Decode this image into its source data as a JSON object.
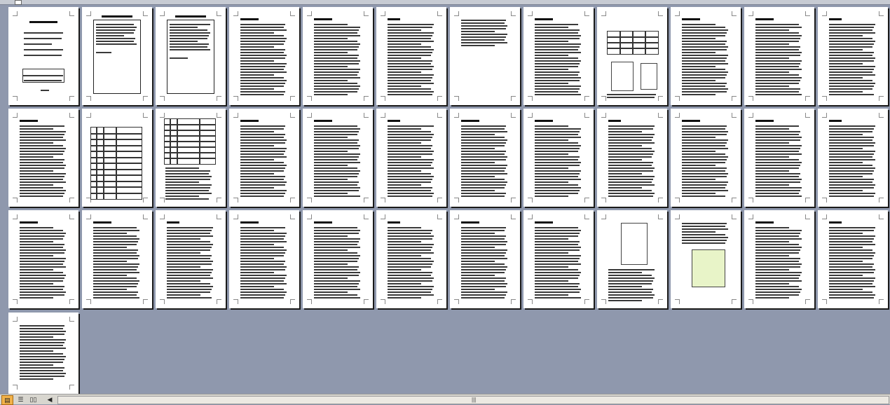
{
  "app": {
    "view_mode": "page-thumbnails",
    "page_count": 37
  },
  "statusbar": {
    "view_buttons": [
      {
        "name": "normal-view",
        "icon": "page-layout-icon",
        "glyph": "▤",
        "active": true
      },
      {
        "name": "outline-view",
        "icon": "outline-icon",
        "glyph": "☰",
        "active": false
      },
      {
        "name": "reading-view",
        "icon": "book-icon",
        "glyph": "📖",
        "active": false
      }
    ],
    "scroll_left_glyph": "◀",
    "scroll_grip": "|||"
  },
  "pages": [
    {
      "n": 1,
      "kind": "cover"
    },
    {
      "n": 2,
      "kind": "framed-text"
    },
    {
      "n": 3,
      "kind": "framed-text"
    },
    {
      "n": 4,
      "kind": "text"
    },
    {
      "n": 5,
      "kind": "text"
    },
    {
      "n": 6,
      "kind": "text"
    },
    {
      "n": 7,
      "kind": "text-short"
    },
    {
      "n": 8,
      "kind": "text"
    },
    {
      "n": 9,
      "kind": "table-drawing"
    },
    {
      "n": 10,
      "kind": "text"
    },
    {
      "n": 11,
      "kind": "text"
    },
    {
      "n": 12,
      "kind": "text"
    },
    {
      "n": 13,
      "kind": "text"
    },
    {
      "n": 14,
      "kind": "table"
    },
    {
      "n": 15,
      "kind": "table-short"
    },
    {
      "n": 16,
      "kind": "text"
    },
    {
      "n": 17,
      "kind": "text"
    },
    {
      "n": 18,
      "kind": "text"
    },
    {
      "n": 19,
      "kind": "text"
    },
    {
      "n": 20,
      "kind": "text"
    },
    {
      "n": 21,
      "kind": "text"
    },
    {
      "n": 22,
      "kind": "text"
    },
    {
      "n": 23,
      "kind": "text"
    },
    {
      "n": 24,
      "kind": "text"
    },
    {
      "n": 25,
      "kind": "text"
    },
    {
      "n": 26,
      "kind": "text"
    },
    {
      "n": 27,
      "kind": "text"
    },
    {
      "n": 28,
      "kind": "text"
    },
    {
      "n": 29,
      "kind": "text"
    },
    {
      "n": 30,
      "kind": "text"
    },
    {
      "n": 31,
      "kind": "text"
    },
    {
      "n": 32,
      "kind": "text"
    },
    {
      "n": 33,
      "kind": "drawing"
    },
    {
      "n": 34,
      "kind": "drawing-color"
    },
    {
      "n": 35,
      "kind": "text"
    },
    {
      "n": 36,
      "kind": "text"
    },
    {
      "n": 37,
      "kind": "text-short"
    }
  ]
}
